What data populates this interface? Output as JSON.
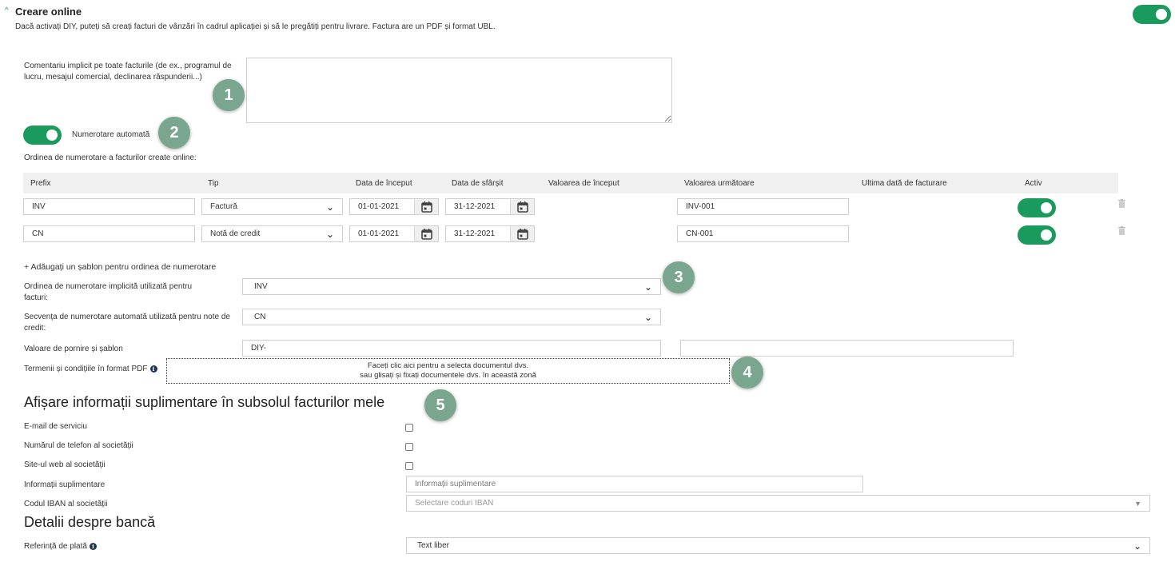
{
  "section": {
    "title": "Creare online",
    "description": "Dacă activați DIY, puteți să creați facturi de vânzări în cadrul aplicației și să le pregătiți pentru livrare. Factura are un PDF și format UBL.",
    "enabled": true
  },
  "comment": {
    "label": "Comentariu implicit pe toate facturile (de ex., programul de lucru, mesajul comercial, declinarea răspunderii...)",
    "value": ""
  },
  "auto_numbering": {
    "label": "Numerotare automată",
    "enabled": true
  },
  "numbering_order_title": "Ordinea de numerotare a facturilor create online:",
  "table": {
    "headers": [
      "Prefix",
      "Tip",
      "Data de început",
      "Data de sfârșit",
      "Valoarea de început",
      "Valoarea următoare",
      "Ultima dată de facturare",
      "Activ"
    ],
    "rows": [
      {
        "prefix": "INV",
        "type": "Factură",
        "start_date": "01-01-2021",
        "end_date": "31-12-2021",
        "start_value": "",
        "next_value": "INV-001",
        "last_invoice_date": "",
        "active": true
      },
      {
        "prefix": "CN",
        "type": "Notă de credit",
        "start_date": "01-01-2021",
        "end_date": "31-12-2021",
        "start_value": "",
        "next_value": "CN-001",
        "last_invoice_date": "",
        "active": true
      }
    ]
  },
  "add_template_link": "+ Adăugați un șablon pentru ordinea de numerotare",
  "default_invoice_sequence": {
    "label": "Ordinea de numerotare implicită utilizată pentru facturi:",
    "value": "INV"
  },
  "credit_note_sequence": {
    "label": "Secvența de numerotare automată utilizată pentru note de credit:",
    "value": "CN"
  },
  "start_value_template": {
    "label": "Valoare de pornire și șablon",
    "value": "DIY-",
    "value2": ""
  },
  "terms": {
    "label": "Termenii și condițiile în format PDF",
    "dropzone_line1": "Faceți clic aici pentru a selecta documentul dvs.",
    "dropzone_line2": "sau glisați și fixați documentele dvs. în această zonă"
  },
  "footer_section": {
    "title": "Afișare informații suplimentare în subsolul facturilor mele",
    "service_email": "E-mail de serviciu",
    "company_phone": "Numărul de telefon al societății",
    "company_website": "Site-ul web al societății",
    "extra_info_label": "Informații suplimentare",
    "extra_info_placeholder": "Informații suplimentare",
    "iban_label": "Codul IBAN al societății",
    "iban_placeholder": "Selectare coduri IBAN"
  },
  "bank_section": {
    "title": "Detalii despre bancă",
    "payment_ref_label": "Referință de plată",
    "payment_ref_value": "Text liber"
  },
  "callouts": [
    "1",
    "2",
    "3",
    "4",
    "5"
  ],
  "colors": {
    "accent": "#1a9a5c",
    "callout": "#7aa58f",
    "table_header_bg": "#f0f0f0"
  }
}
